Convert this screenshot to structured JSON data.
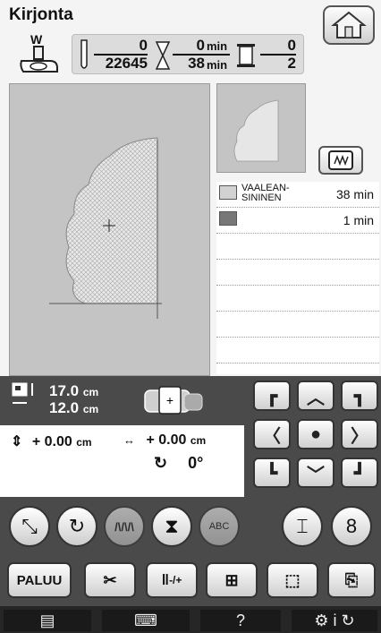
{
  "title": "Kirjonta",
  "presser_foot_letter": "W",
  "info": {
    "stitch_current": "0",
    "stitch_total": "22645",
    "time_current": "0",
    "time_total": "38",
    "time_unit": "min",
    "color_current": "0",
    "color_total": "2"
  },
  "colors": [
    {
      "name": "VAALEAN-\nSININEN",
      "time": "38 min",
      "swatch": "#d2d2d2"
    },
    {
      "name": "",
      "time": "1 min",
      "swatch": "#777777"
    }
  ],
  "size": {
    "height": "17.0",
    "width": "12.0",
    "unit": "cm"
  },
  "offset": {
    "vertical": "+ 0.00",
    "horizontal": "+ 0.00",
    "unit": "cm",
    "rotation": "0°"
  },
  "buttons": {
    "back_label": "PALUU",
    "thread_tension_label": "-/+",
    "help_label": "?"
  },
  "icons": {
    "home": "home-icon",
    "center": "center-dot-icon"
  }
}
